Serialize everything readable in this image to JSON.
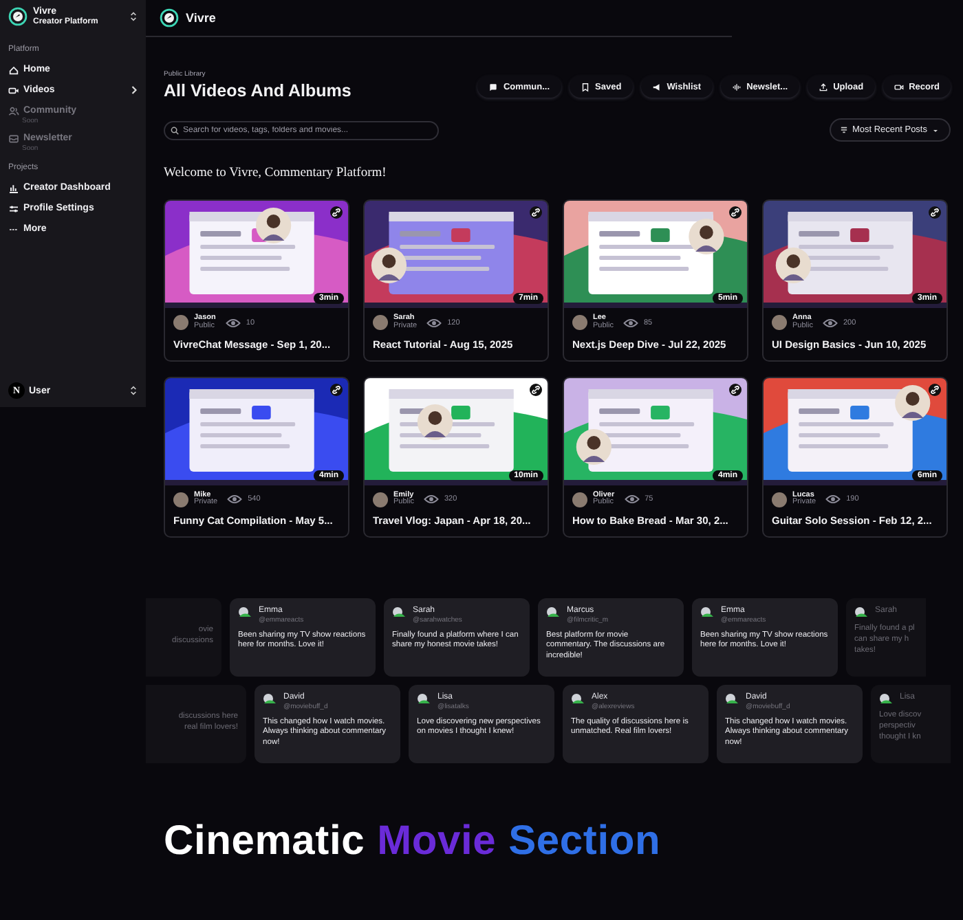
{
  "sidebar": {
    "brand": {
      "name": "Vivre",
      "subtitle": "Creator Platform"
    },
    "sections": [
      {
        "label": "Platform",
        "items": [
          {
            "label": "Home",
            "disabled": false,
            "expandable": false
          },
          {
            "label": "Videos",
            "disabled": false,
            "expandable": true
          },
          {
            "label": "Community",
            "disabled": true,
            "expandable": false,
            "badge": "Soon"
          },
          {
            "label": "Newsletter",
            "disabled": true,
            "expandable": false,
            "badge": "Soon"
          }
        ]
      },
      {
        "label": "Projects",
        "items": [
          {
            "label": "Creator Dashboard",
            "disabled": false,
            "expandable": false
          },
          {
            "label": "Profile Settings",
            "disabled": false,
            "expandable": false
          },
          {
            "label": "More",
            "disabled": false,
            "expandable": false
          }
        ]
      }
    ],
    "user": {
      "initial": "N",
      "name": "User"
    }
  },
  "header": {
    "title": "Vivre"
  },
  "library": {
    "eyebrow": "Public Library",
    "title": "All Videos And Albums",
    "actions": [
      {
        "label": "Commun..."
      },
      {
        "label": "Saved"
      },
      {
        "label": "Wishlist"
      },
      {
        "label": "Newslet..."
      },
      {
        "label": "Upload"
      },
      {
        "label": "Record"
      }
    ],
    "search": {
      "placeholder": "Search for videos, tags, folders and movies..."
    },
    "sort": {
      "label": "Most Recent Posts"
    },
    "welcome": "Welcome to Vivre, Commentary Platform!"
  },
  "videos": [
    {
      "author": "Jason",
      "visibility": "Public",
      "views": "10",
      "title": "VivreChat Message - Sep 1, 20...",
      "duration": "3min"
    },
    {
      "author": "Sarah",
      "visibility": "Private",
      "views": "120",
      "title": "React Tutorial - Aug 15, 2025",
      "duration": "7min"
    },
    {
      "author": "Lee",
      "visibility": "Public",
      "views": "85",
      "title": "Next.js Deep Dive - Jul 22, 2025",
      "duration": "5min"
    },
    {
      "author": "Anna",
      "visibility": "Public",
      "views": "200",
      "title": "UI Design Basics - Jun 10, 2025",
      "duration": "3min"
    },
    {
      "author": "Mike",
      "visibility": "Private",
      "views": "540",
      "title": "Funny Cat Compilation - May 5...",
      "duration": "4min"
    },
    {
      "author": "Emily",
      "visibility": "Public",
      "views": "320",
      "title": "Travel Vlog: Japan - Apr 18, 20...",
      "duration": "10min"
    },
    {
      "author": "Oliver",
      "visibility": "Public",
      "views": "75",
      "title": "How to Bake Bread - Mar 30, 2...",
      "duration": "4min"
    },
    {
      "author": "Lucas",
      "visibility": "Private",
      "views": "190",
      "title": "Guitar Solo Session - Feb 12, 2...",
      "duration": "6min"
    }
  ],
  "testimonials": [
    {
      "cards": [
        {
          "kind": "partial",
          "text": "ovie\ndiscussions"
        },
        {
          "kind": "full",
          "name": "Emma",
          "handle": "@emmareacts",
          "text": "Been sharing my TV show reactions here for months. Love it!"
        },
        {
          "kind": "full",
          "name": "Sarah",
          "handle": "@sarahwatches",
          "text": "Finally found a platform where I can share my honest movie takes!"
        },
        {
          "kind": "full",
          "name": "Marcus",
          "handle": "@filmcritic_m",
          "text": "Best platform for movie commentary. The discussions are incredible!"
        },
        {
          "kind": "full",
          "name": "Emma",
          "handle": "@emmareacts",
          "text": "Been sharing my TV show reactions here for months. Love it!"
        },
        {
          "kind": "edge",
          "name": "Sarah",
          "text": "Finally found a pl\ncan share my h\ntakes!"
        }
      ]
    },
    {
      "cards": [
        {
          "kind": "partial",
          "text": "discussions here\nreal film lovers!"
        },
        {
          "kind": "full",
          "name": "David",
          "handle": "@moviebuff_d",
          "text": "This changed how I watch movies. Always thinking about commentary now!"
        },
        {
          "kind": "full",
          "name": "Lisa",
          "handle": "@lisatalks",
          "text": "Love discovering new perspectives on movies I thought I knew!"
        },
        {
          "kind": "full",
          "name": "Alex",
          "handle": "@alexreviews",
          "text": "The quality of discussions here is unmatched. Real film lovers!"
        },
        {
          "kind": "full",
          "name": "David",
          "handle": "@moviebuff_d",
          "text": "This changed how I watch movies. Always thinking about commentary now!"
        },
        {
          "kind": "edge",
          "name": "Lisa",
          "text": "Love discov\nperspectiv\nthought I kn"
        }
      ]
    }
  ],
  "showcase": {
    "parts": [
      {
        "text": "Cinematic",
        "kind": "plain"
      },
      {
        "text": "Movie",
        "kind": "purple"
      },
      {
        "text": "Section",
        "kind": "blue"
      }
    ]
  }
}
